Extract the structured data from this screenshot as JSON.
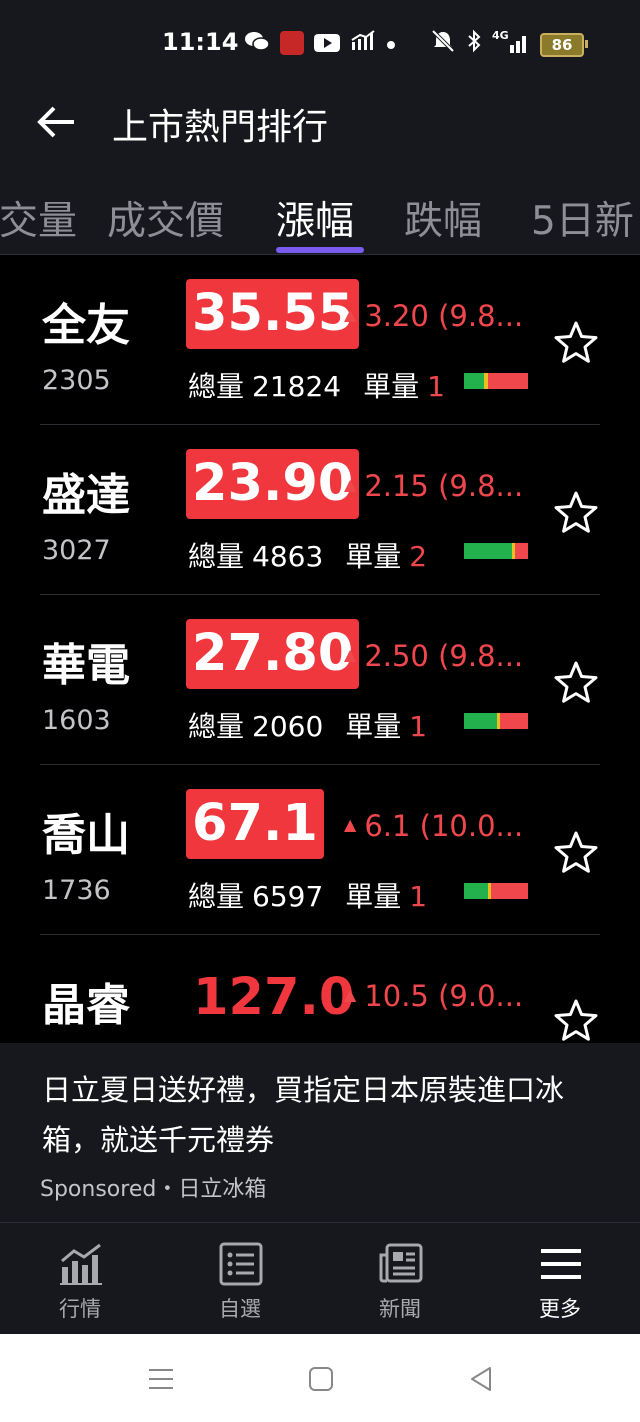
{
  "status_bar": {
    "time": "11:14",
    "network": "4G",
    "battery": "86"
  },
  "header": {
    "title": "上市熱門排行"
  },
  "tabs": [
    {
      "label": "成交量"
    },
    {
      "label": "成交價"
    },
    {
      "label": "漲幅"
    },
    {
      "label": "跌幅"
    },
    {
      "label": "5日新"
    }
  ],
  "stocks": [
    {
      "name": "全友",
      "code": "2305",
      "price": "35.55",
      "change": "3.20 (9.8...",
      "volume_label": "總量",
      "volume": "21824",
      "unit_label": "單量",
      "unit": "1",
      "bar": {
        "green": 0.32,
        "yellow": 0.06,
        "red": 0.62
      }
    },
    {
      "name": "盛達",
      "code": "3027",
      "price": "23.90",
      "change": "2.15 (9.8...",
      "volume_label": "總量",
      "volume": "4863",
      "unit_label": "單量",
      "unit": "2",
      "bar": {
        "green": 0.75,
        "yellow": 0.05,
        "red": 0.2
      }
    },
    {
      "name": "華電",
      "code": "1603",
      "price": "27.80",
      "change": "2.50 (9.8...",
      "volume_label": "總量",
      "volume": "2060",
      "unit_label": "單量",
      "unit": "1",
      "bar": {
        "green": 0.52,
        "yellow": 0.05,
        "red": 0.43
      }
    },
    {
      "name": "喬山",
      "code": "1736",
      "price": "67.1",
      "change": "6.1 (10.0...",
      "volume_label": "總量",
      "volume": "6597",
      "unit_label": "單量",
      "unit": "1",
      "bar": {
        "green": 0.38,
        "yellow": 0.04,
        "red": 0.58
      }
    },
    {
      "name": "晶睿",
      "code": "",
      "price": "127.0",
      "change": "10.5 (9.0..."
    }
  ],
  "ad": {
    "text": "日立夏日送好禮，買指定日本原裝進口冰箱，就送千元禮券",
    "sponsor": "Sponsored・日立冰箱"
  },
  "bottom_nav": [
    {
      "label": "行情",
      "icon": "chart-icon"
    },
    {
      "label": "自選",
      "icon": "list-icon"
    },
    {
      "label": "新聞",
      "icon": "news-icon"
    },
    {
      "label": "更多",
      "icon": "menu-icon"
    }
  ],
  "colors": {
    "up_red": "#f0373d",
    "bar_green": "#22b14c",
    "bar_yellow": "#e8c020",
    "bar_red": "#f0474d",
    "tab_indicator": "#7a5cf0",
    "panel": "#16181d"
  }
}
